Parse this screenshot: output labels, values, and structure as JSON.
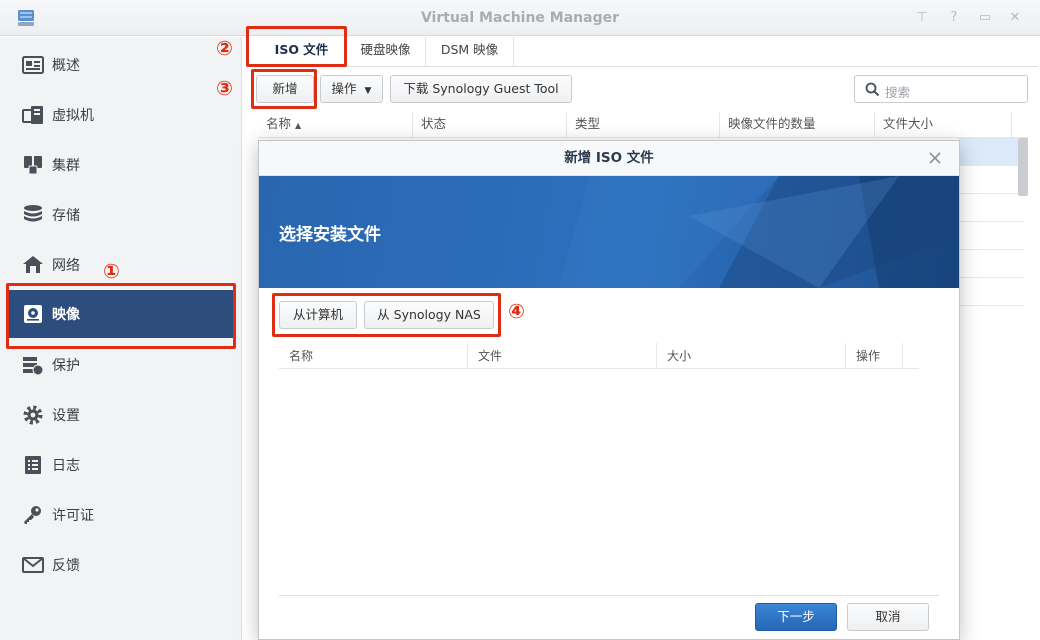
{
  "window": {
    "title": "Virtual Machine Manager",
    "controls": [
      "pin-icon",
      "question-icon",
      "minimize-icon",
      "maximize-icon",
      "close-icon"
    ]
  },
  "sidebar": {
    "items": [
      {
        "label": "概述",
        "icon": "overview-icon"
      },
      {
        "label": "虚拟机",
        "icon": "vm-icon"
      },
      {
        "label": "集群",
        "icon": "cluster-icon"
      },
      {
        "label": "存储",
        "icon": "storage-icon"
      },
      {
        "label": "网络",
        "icon": "network-icon"
      },
      {
        "label": "映像",
        "icon": "image-icon",
        "active": true
      },
      {
        "label": "保护",
        "icon": "protection-icon"
      },
      {
        "label": "设置",
        "icon": "settings-icon"
      },
      {
        "label": "日志",
        "icon": "log-icon"
      },
      {
        "label": "许可证",
        "icon": "license-icon"
      },
      {
        "label": "反馈",
        "icon": "feedback-icon"
      }
    ]
  },
  "tabs": [
    "ISO 文件",
    "硬盘映像",
    "DSM 映像"
  ],
  "toolbar": {
    "create": "新增",
    "action": "操作",
    "download": "下载 Synology Guest Tool",
    "search_placeholder": "搜索"
  },
  "grid": {
    "columns": [
      "名称",
      "状态",
      "类型",
      "映像文件的数量",
      "文件大小"
    ]
  },
  "dialog": {
    "title": "新增 ISO 文件",
    "banner": "选择安装文件",
    "from_computer": "从计算机",
    "from_nas": "从 Synology NAS",
    "columns": [
      "名称",
      "文件",
      "大小",
      "操作"
    ],
    "next": "下一步",
    "cancel": "取消"
  },
  "annotations": {
    "m1": "①",
    "m2": "②",
    "m3": "③",
    "m4": "④"
  },
  "colors": {
    "accent": "#2c4d7e",
    "highlight": "#e02c12",
    "primary_button": "#2a6fc0"
  }
}
